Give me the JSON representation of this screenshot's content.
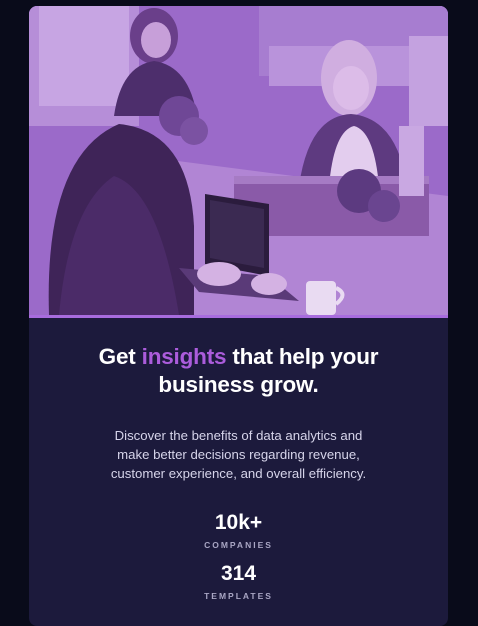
{
  "hero": {
    "image_description_icon": "office-photo-icon",
    "tint_color": "#9a68c8"
  },
  "headline": {
    "before": "Get ",
    "highlight": "insights",
    "after_line1": " that help your",
    "line2": "business grow."
  },
  "description": {
    "line1": "Discover the benefits of data analytics and",
    "line2": "make better decisions regarding revenue,",
    "line3": "customer experience, and overall efficiency."
  },
  "stats": [
    {
      "value": "10k+",
      "label": "COMPANIES"
    },
    {
      "value": "314",
      "label": "TEMPLATES"
    }
  ],
  "colors": {
    "page_background": "#090b1a",
    "card_background": "#1c1a3c",
    "accent": "#ab5cdb",
    "text_primary": "#ffffff",
    "text_secondary": "#d6d4ea",
    "stat_label": "#a9a6c4"
  }
}
